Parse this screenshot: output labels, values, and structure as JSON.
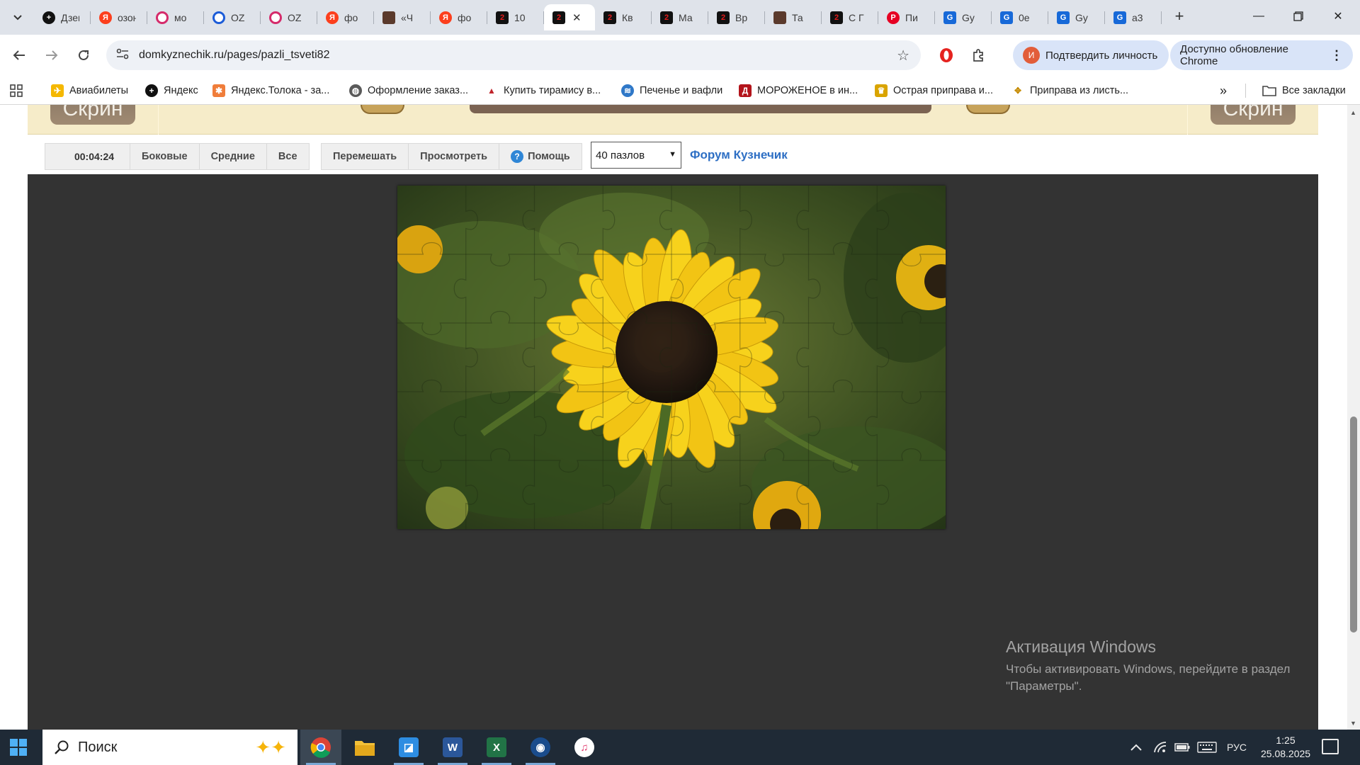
{
  "tabs": [
    {
      "title": "Дзен",
      "icon": "dzen"
    },
    {
      "title": "озон",
      "icon": "yandex"
    },
    {
      "title": "мо",
      "icon": "ozon"
    },
    {
      "title": "OZ",
      "icon": "ozon2"
    },
    {
      "title": "OZ",
      "icon": "ozon"
    },
    {
      "title": "фо",
      "icon": "yandex"
    },
    {
      "title": "«Ч",
      "icon": "brown"
    },
    {
      "title": "фо",
      "icon": "yandex"
    },
    {
      "title": "10",
      "icon": "kz"
    },
    {
      "title": "",
      "icon": "kz",
      "active": true
    },
    {
      "title": "Кв",
      "icon": "kz"
    },
    {
      "title": "Ма",
      "icon": "kz"
    },
    {
      "title": "Вр",
      "icon": "kz"
    },
    {
      "title": "Та",
      "icon": "brown"
    },
    {
      "title": "С Г",
      "icon": "kz"
    },
    {
      "title": "Пи",
      "icon": "pin"
    },
    {
      "title": "Gy",
      "icon": "gu"
    },
    {
      "title": "0e",
      "icon": "gu"
    },
    {
      "title": "Gy",
      "icon": "gu"
    },
    {
      "title": "a3",
      "icon": "gu"
    }
  ],
  "browser": {
    "url": "domkyznechik.ru/pages/pazli_tsveti82",
    "profile_button": "Подтвердить личность",
    "profile_initial": "И",
    "update_button": "Доступно обновление Chrome"
  },
  "bookmarks": [
    {
      "label": "Авиабилеты",
      "icon": "plane-icon"
    },
    {
      "label": "Яндекс",
      "icon": "yandex-icon"
    },
    {
      "label": "Яндекс.Толока - за...",
      "icon": "toloka-icon"
    },
    {
      "label": "Оформление заказ...",
      "icon": "globe-icon"
    },
    {
      "label": "Купить тирамису в...",
      "icon": "tiramisu-icon"
    },
    {
      "label": "Печенье и вафли",
      "icon": "cookie-icon"
    },
    {
      "label": "МОРОЖЕНОЕ в ин...",
      "icon": "icecream-icon"
    },
    {
      "label": "Острая приправа и...",
      "icon": "spice-icon"
    },
    {
      "label": "Приправа из листь...",
      "icon": "herb-icon"
    }
  ],
  "bookmarks_more": "»",
  "all_bookmarks": "Все закладки",
  "site_header": {
    "left_button": "Скрин",
    "right_button": "Скрин"
  },
  "controls": {
    "timer": "00:04:24",
    "sides": "Боковые",
    "middle": "Средние",
    "all": "Все",
    "shuffle": "Перемешать",
    "preview": "Просмотреть",
    "help": "Помощь",
    "pieces_selected": "40 пазлов",
    "forum_link": "Форум Кузнечик"
  },
  "activation": {
    "title": "Активация Windows",
    "text": "Чтобы активировать Windows, перейдите в раздел \"Параметры\"."
  },
  "taskbar": {
    "search_placeholder": "Поиск",
    "language": "РУС",
    "time": "1:25",
    "date": "25.08.2025"
  },
  "colors": {
    "board_bg": "#333333",
    "header_bg": "#f6ecc9",
    "forum_link": "#2e6fc4",
    "taskbar_bg": "#1f2a36"
  }
}
